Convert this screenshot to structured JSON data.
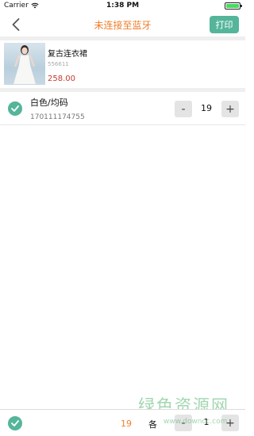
{
  "status_bar": {
    "carrier": "Carrier",
    "time": "1:38 PM"
  },
  "nav": {
    "title": "未连接至蓝牙",
    "print_label": "打印"
  },
  "product": {
    "name": "复古连衣裙",
    "code": "556611",
    "price": "258.00"
  },
  "sku": {
    "name": "白色/均码",
    "code": "170111174755",
    "quantity": "19"
  },
  "stepper": {
    "minus": "-",
    "plus": "+"
  },
  "bottom": {
    "total_quantity": "19",
    "each_label": "各",
    "each_quantity": "1"
  },
  "watermark": {
    "text": "绿色资源网",
    "url": "www.downcc.com"
  },
  "colors": {
    "accent_green": "#54b59a",
    "title_orange": "#f07d2a",
    "price_red": "#c23b2e"
  }
}
